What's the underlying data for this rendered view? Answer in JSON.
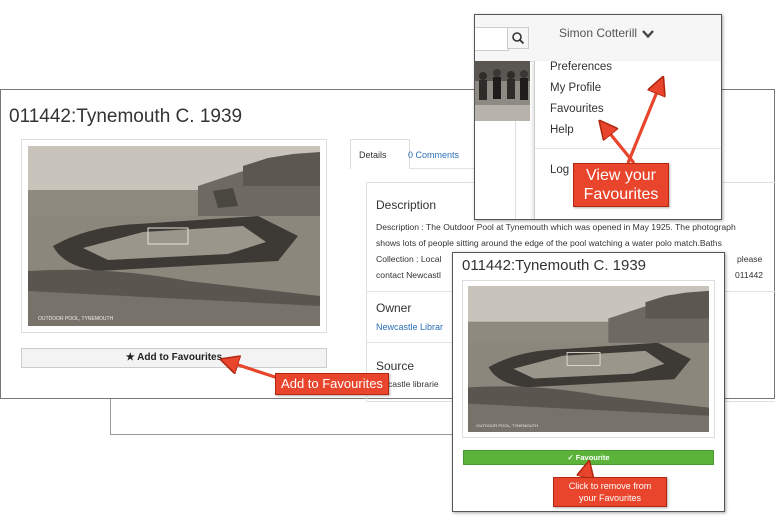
{
  "record": {
    "title": "011442:Tynemouth C. 1939",
    "photo_caption": "OUTDOOR POOL, TYNEMOUTH",
    "add_button": "★ Add to Favourites",
    "tabs": [
      "Details",
      "0 Comments"
    ],
    "description_title": "Description",
    "description_lines": [
      "Description : The Outdoor Pool at Tynemouth which was opened in May 1925. The photograph",
      "shows lots of people sitting around the edge of the pool watching a water polo match.Baths",
      "Collection : Local",
      "contact Newcastl"
    ],
    "description_right": [
      "please",
      "011442"
    ],
    "owner_title": "Owner",
    "owner_value": "Newcastle Librar",
    "source_title": "Source",
    "source_value": "castle librarie"
  },
  "user_menu": {
    "user_name": "Simon Cotterill",
    "items": [
      "Preferences",
      "My Profile",
      "Favourites",
      "Help"
    ],
    "logout_partial": "Log"
  },
  "favourite_view": {
    "title": "011442:Tynemouth C. 1939",
    "button": "✓ Favourite"
  },
  "callouts": {
    "view_favourites": [
      "View your",
      "Favourites"
    ],
    "add_favourites": "Add to Favourites",
    "remove_favourites": [
      "Click to remove from",
      "your Favourites"
    ]
  },
  "colors": {
    "callout": "#e8452c",
    "green_button": "#5bb33a",
    "link": "#2a6fb7"
  }
}
